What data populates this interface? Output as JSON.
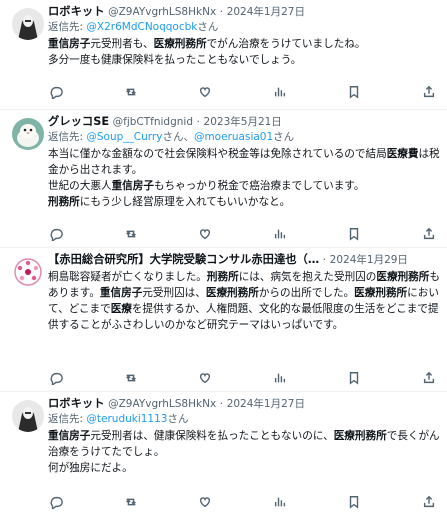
{
  "reply_prefix": "返信先:",
  "san_suffix": "さん",
  "and_join": "、",
  "tweets": [
    {
      "name": "ロボキット",
      "handle": "@Z9AYvgrhLS8HkNx",
      "date": "2024年1月27日",
      "reply_to": [
        "@X2r6MdCNoqqocbk"
      ],
      "paragraphs": [
        [
          {
            "t": "重信房子",
            "b": true
          },
          {
            "t": "元受刑者も、"
          },
          {
            "t": "医療刑務所",
            "b": true
          },
          {
            "t": "でがん治療をうけていましたね。"
          }
        ],
        [
          {
            "t": "多分一度も健康保険料を払ったこともないでしょう。"
          }
        ]
      ]
    },
    {
      "name": "グレッコSE",
      "handle": "@fjbCTfnidgnid",
      "date": "2023年5月21日",
      "reply_to": [
        "@Soup__Curry",
        "@moeruasia01"
      ],
      "paragraphs": [
        [
          {
            "t": "本当に僅かな金額なので社会保険料や税金等は免除されているので結局"
          },
          {
            "t": "医療費",
            "b": true
          },
          {
            "t": "は税金から出されます。"
          }
        ],
        [
          {
            "t": "世紀の大悪人"
          },
          {
            "t": "重信房子",
            "b": true
          },
          {
            "t": "もちゃっかり税金で癌治療までしています。"
          }
        ],
        [
          {
            "t": "刑務所",
            "b": true
          },
          {
            "t": "にもう少し経営原理を入れてもいいかなと。"
          }
        ]
      ]
    },
    {
      "name": "【赤田総合研究所】大学院受験コンサル赤田達也（…",
      "handle": "",
      "date": "2024年1月29日",
      "reply_to": [],
      "paragraphs": [
        [
          {
            "t": "桐島聡容疑者が亡くなりました。"
          },
          {
            "t": "刑務所",
            "b": true
          },
          {
            "t": "には、病気を抱えた受刑囚の"
          },
          {
            "t": "医療刑務所",
            "b": true
          },
          {
            "t": "もあります。"
          },
          {
            "t": "重信房子",
            "b": true
          },
          {
            "t": "元受刑囚は、"
          },
          {
            "t": "医療刑務所",
            "b": true
          },
          {
            "t": "からの出所でした。"
          },
          {
            "t": "医療刑務所",
            "b": true
          },
          {
            "t": "において、どこまで"
          },
          {
            "t": "医療",
            "b": true
          },
          {
            "t": "を提供するか、人権問題、文化的な最低限度の生活をどこまで提供することがふさわしいのかなど研究テーマはいっぱいです。"
          }
        ]
      ]
    },
    {
      "name": "ロボキット",
      "handle": "@Z9AYvgrhLS8HkNx",
      "date": "2024年1月27日",
      "reply_to": [
        "@teruduki1113"
      ],
      "paragraphs": [
        [
          {
            "t": "重信房子",
            "b": true
          },
          {
            "t": "元受刑者は、健康保険料を払ったこともないのに、"
          },
          {
            "t": "医療刑務所",
            "b": true
          },
          {
            "t": "で長くがん治療をうけてたでしょ。"
          }
        ],
        [
          {
            "t": "何が独房にだよ。"
          }
        ]
      ]
    }
  ],
  "icons": [
    "reply-icon",
    "retweet-icon",
    "like-icon",
    "views-icon",
    "bookmark-icon",
    "share-icon"
  ]
}
